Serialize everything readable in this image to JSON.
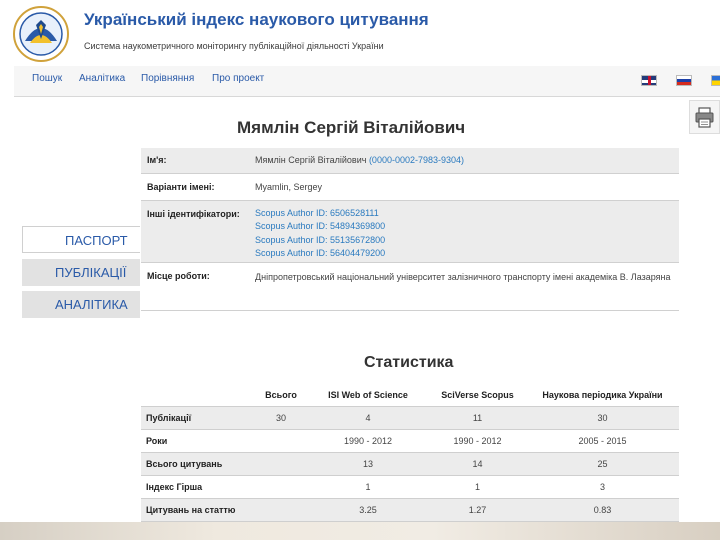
{
  "header": {
    "title": "Український індекс наукового цитування",
    "subtitle": "Система наукометричного моніторингу публікаційної діяльності України"
  },
  "nav": {
    "items": [
      "Пошук",
      "Аналітика",
      "Порівняння",
      "Про проект"
    ],
    "languages": [
      "uk-flag",
      "ru-flag",
      "ua-flag"
    ]
  },
  "toolbar": {
    "print_icon": "printer-icon"
  },
  "sidebar": {
    "tabs": [
      {
        "label": "ПАСПОРТ",
        "active": true
      },
      {
        "label": "ПУБЛІКАЦІЇ",
        "active": false
      },
      {
        "label": "АНАЛІТИКА",
        "active": false
      }
    ]
  },
  "profile": {
    "name": "Мямлін Сергій Віталійович",
    "rows": [
      {
        "label": "Ім'я:",
        "value": "Мямлін Сергій Віталійович",
        "extra": "(0000-0002-7983-9304)"
      },
      {
        "label": "Варіанти імені:",
        "value": "Myamlin, Sergey"
      },
      {
        "label": "Інші ідентифікатори:",
        "ids": [
          "Scopus Author ID: 6506528111",
          "Scopus Author ID: 54894369800",
          "Scopus Author ID: 55135672800",
          "Scopus Author ID: 56404479200"
        ]
      },
      {
        "label": "Місце роботи:",
        "value": "Дніпропетровський національний університет залізничного транспорту імені академіка В. Лазаряна"
      }
    ]
  },
  "stats": {
    "title": "Статистика",
    "columns": [
      "",
      "Всього",
      "ISI Web of Science",
      "SciVerse Scopus",
      "Наукова періодика України"
    ],
    "rows": [
      {
        "label": "Публікації",
        "cells": [
          "30",
          "4",
          "11",
          "30"
        ]
      },
      {
        "label": "Роки",
        "cells": [
          "",
          "1990 - 2012",
          "1990 - 2012",
          "2005 - 2015"
        ]
      },
      {
        "label": "Всього цитувань",
        "cells": [
          "",
          "13",
          "14",
          "25"
        ]
      },
      {
        "label": "Індекс Гірша",
        "cells": [
          "",
          "1",
          "1",
          "3"
        ]
      },
      {
        "label": "Цитувань на статтю",
        "cells": [
          "",
          "3.25",
          "1.27",
          "0.83"
        ]
      }
    ]
  },
  "colors": {
    "link": "#2a5aa8",
    "accent_link": "#2a7abf",
    "title": "#2a5aa8"
  }
}
